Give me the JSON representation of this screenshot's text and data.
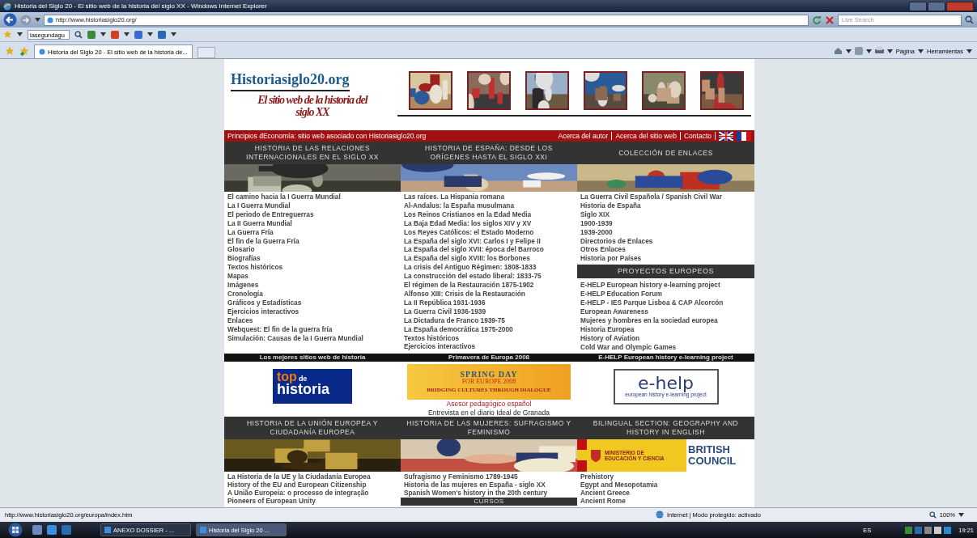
{
  "window": {
    "title": "Historia del Siglo 20 - El sitio web de la historia del siglo XX - Windows Internet Explorer"
  },
  "address_bar": {
    "url": "http://www.historiasiglo20.org/",
    "search_placeholder": "Live Search"
  },
  "links_bar": {
    "search_value": "lasegundagu"
  },
  "tabs": [
    {
      "label": "Historia del Siglo 20 - El sitio web de la historia de...",
      "selected": true
    }
  ],
  "command_bar": [
    {
      "label": "Página"
    },
    {
      "label": "Herramientas"
    }
  ],
  "site": {
    "logo": "Historiasiglo20.org",
    "tagline": "El sitio web de la historia del siglo XX",
    "red_bar": {
      "text": "Principios dEconomía: sitio web asociado con Historiasiglo20.org",
      "links": [
        "Acerca del autor",
        "Acerca del sitio web",
        "Contacto"
      ]
    },
    "sections_top": [
      {
        "heading": "HISTORIA DE LAS RELACIONES INTERNACIONALES EN EL SIGLO XX",
        "links": [
          "El camino hacia la I Guerra Mundial",
          "La I Guerra Mundial",
          "El periodo de Entreguerras",
          "La II Guerra Mundial",
          "La Guerra Fría",
          "El fin de la Guerra Fría",
          "Glosario",
          "Biografías",
          "Textos históricos",
          "Mapas",
          "Imágenes",
          "Cronología",
          "Gráficos y Estadísticas",
          "Ejercicios interactivos",
          "Enlaces",
          "Webquest: El fin de la guerra fría",
          "Simulación: Causas de la I Guerra Mundial"
        ]
      },
      {
        "heading": "HISTORIA DE ESPAÑA: DESDE LOS ORÍGENES HASTA EL SIGLO XXI",
        "links": [
          "Las raíces. La Hispania romana",
          "Al-Andalus: la España musulmana",
          "Los Reinos Cristianos en la Edad Media",
          "La Baja Edad Media: los siglos XIV y XV",
          "Los Reyes Católicos: el Estado Moderno",
          "La España del siglo XVI: Carlos I y Felipe II",
          "La España del siglo XVII: época del Barroco",
          "La España del siglo XVIII: los Borbones",
          "La crisis del Antiguo Régimen: 1808-1833",
          "La construcción del estado liberal: 1833-75",
          "El régimen de la Restauración 1875-1902",
          "Alfonso XIII: Crisis de la Restauración",
          "La II República 1931-1936",
          "La Guerra Civil 1936-1939",
          "La Dictadura de Franco 1939-75",
          "La España democrática 1975-2000",
          "Textos históricos",
          "Ejercicios interactivos"
        ]
      },
      {
        "heading": "COLECCIÓN DE ENLACES",
        "links": [
          "La Guerra Civil Española / Spanish Civil War",
          "Historia de España",
          "Siglo XIX",
          "1900-1939",
          "1939-2000",
          "Directorios de Enlaces",
          "Otros Enlaces",
          "Historia por Países"
        ],
        "subsection": {
          "heading": "PROYECTOS EUROPEOS",
          "links": [
            "E-HELP European history e-learning project",
            "E-HELP Education Forum",
            "E-HELP - IES Parque Lisboa & CAP Alcorcón",
            "European Awareness",
            "Mujeres y hombres en la sociedad europea",
            "Historia Europea",
            "History of Aviation",
            "Cold War and Olympic Games"
          ]
        }
      }
    ],
    "banner_titles": [
      "Los mejores sitios web de historia",
      "Primavera de Europa 2008",
      "E-HELP European history e-learning project"
    ],
    "top_historia": [
      "top",
      "de",
      "historia"
    ],
    "spring_day": {
      "title": "SPRING DAY",
      "subtitle": "FOR EUROPE 2008",
      "motto": "BRIDGING CULTURES THROUGH DIALOGUE"
    },
    "captions": [
      {
        "text": "Asesor pedagógico español",
        "kind": "highlight"
      },
      {
        "text": "Entrevista en el diario  Ideal de Granada",
        "kind": "plain"
      }
    ],
    "ehelp": {
      "logo": "e-help",
      "tagline": "european history e-learning project"
    },
    "sections_bottom": [
      {
        "heading": "HISTORIA DE LA UNIÓN EUROPEA Y CIUDADANÍA EUROPEA",
        "links": [
          "La Historia de la UE y la Ciudadanía Europea",
          "History of the EU and European Citizenship",
          "A União Europeia: o processo de integração",
          "Pioneers of European Unity"
        ]
      },
      {
        "heading": "HISTORIA DE LAS MUJERES: SUFRAGISMO Y FEMINISMO",
        "links": [
          "Sufragismo y Feminismo 1789-1945",
          "Historia de las mujeres en España - siglo XX",
          "Spanish Women's history in the 20th century"
        ],
        "subsection": {
          "heading": "CURSOS"
        }
      },
      {
        "heading": "BILINGUAL SECTION:   GEOGRAPHY AND HISTORY IN ENGLISH",
        "links": [
          "Prehistory",
          "Egypt and Mesopotamia",
          "Ancient Greece",
          "Ancient Rome"
        ],
        "ministry": "MINISTERIO DE EDUCACIÓN Y CIENCIA",
        "council": "BRITISH COUNCIL"
      }
    ]
  },
  "status_bar": {
    "url": "http://www.historiasiglo20.org/europa/index.htm",
    "zone": "Internet | Modo protegido: activado",
    "zoom": "100%"
  },
  "taskbar": {
    "items": [
      {
        "label": "ANEXO DOSSIER - ...",
        "selected": false
      },
      {
        "label": "Historia del Siglo 20 ...",
        "selected": true
      }
    ],
    "language": "ES",
    "clock": "19:21"
  }
}
